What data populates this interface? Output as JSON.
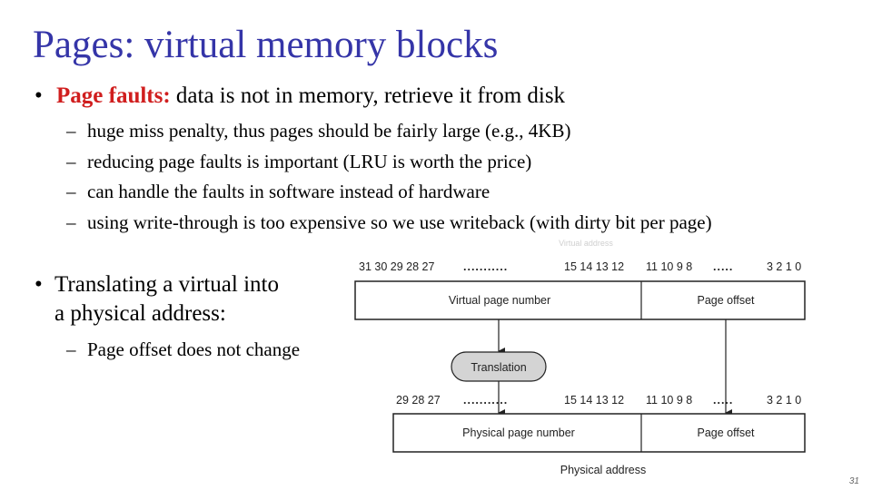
{
  "slide": {
    "title": "Pages:  virtual memory blocks",
    "page_number": "31",
    "bullets": [
      {
        "symbol": "•",
        "highlight": "Page faults:",
        "text": " data is not in memory, retrieve it from disk",
        "highlight_color": "#d01e1e",
        "subitems": [
          {
            "symbol": "–",
            "text": "huge miss penalty, thus pages should be fairly large (e.g., 4KB)"
          },
          {
            "symbol": "–",
            "text": "reducing page faults is important (LRU is worth the price)"
          },
          {
            "symbol": "–",
            "text": "can handle the faults in software instead of hardware"
          },
          {
            "symbol": "–",
            "text": "using write-through is too expensive so we use writeback (with dirty bit per page)"
          }
        ]
      },
      {
        "symbol": "•",
        "line1": "Translating a virtual into",
        "line2": "a physical address:",
        "subitems": [
          {
            "symbol": "–",
            "text": "Page offset does not change"
          }
        ]
      }
    ],
    "title_color": "#3535a8"
  },
  "diagram": {
    "virtual": {
      "caption": "Virtual address",
      "bits_high": "31 30 29 28 27",
      "dots_high": "...........",
      "bits_mid": "15 14 13 12",
      "bits_low": "11 10 9 8",
      "dots_low": ".....",
      "bits_end": "3 2 1 0",
      "field_page": "Virtual page number",
      "field_offset": "Page offset"
    },
    "translation_label": "Translation",
    "physical": {
      "caption": "Physical address",
      "bits_high": "29 28 27",
      "dots_high": "...........",
      "bits_mid": "15 14 13 12",
      "bits_low": "11 10 9 8",
      "dots_low": ".....",
      "bits_end": "3 2 1 0",
      "field_page": "Physical page number",
      "field_offset": "Page offset"
    }
  }
}
